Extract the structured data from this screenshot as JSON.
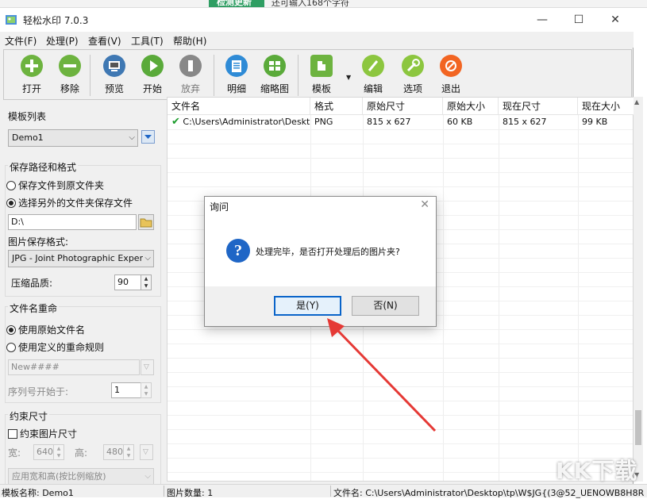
{
  "background": {
    "tab_label": "检测更新",
    "text": "还可输入168个字符"
  },
  "window": {
    "title": "轻松水印 7.0.3",
    "controls": {
      "minimize": "—",
      "maximize": "☐",
      "close": "✕"
    }
  },
  "menu": {
    "items": [
      "文件(F)",
      "处理(P)",
      "查看(V)",
      "工具(T)",
      "帮助(H)"
    ]
  },
  "toolbar": {
    "buttons": [
      {
        "label": "打开",
        "icon": "plus-icon",
        "color": "#6db33f"
      },
      {
        "label": "移除",
        "icon": "minus-icon",
        "color": "#6db33f"
      },
      {
        "label": "预览",
        "icon": "preview-icon",
        "color": "#3f78b3"
      },
      {
        "label": "开始",
        "icon": "play-icon",
        "color": "#5aaa3a"
      },
      {
        "label": "放弃",
        "icon": "stop-icon",
        "color": "#888888"
      },
      {
        "label": "明细",
        "icon": "detail-icon",
        "color": "#2f8bd6"
      },
      {
        "label": "缩略图",
        "icon": "thumbnail-icon",
        "color": "#5aaa3a"
      },
      {
        "label": "模板",
        "icon": "template-icon",
        "color": "#6db33f"
      },
      {
        "label": "编辑",
        "icon": "edit-icon",
        "color": "#8cc63f"
      },
      {
        "label": "选项",
        "icon": "options-icon",
        "color": "#8cc63f"
      },
      {
        "label": "退出",
        "icon": "exit-icon",
        "color": "#f26522"
      }
    ]
  },
  "left_panel": {
    "template_list": {
      "title": "模板列表",
      "selected": "Demo1"
    },
    "save_path": {
      "title": "保存路径和格式",
      "option_original": "保存文件到原文件夹",
      "option_other": "选择另外的文件夹保存文件",
      "path_value": "D:\\",
      "format_label": "图片保存格式:",
      "format_selected": "JPG - Joint Photographic Experts (",
      "quality_label": "压缩品质:",
      "quality_value": "90"
    },
    "rename": {
      "title": "文件名重命",
      "option_original": "使用原始文件名",
      "option_custom": "使用定义的重命规则",
      "pattern_value": "New####",
      "seq_label": "序列号开始于:",
      "seq_value": "1"
    },
    "constrain": {
      "title": "约束尺寸",
      "checkbox_label": "约束图片尺寸",
      "width_label": "宽:",
      "width_value": "640",
      "height_label": "高:",
      "height_value": "480",
      "mode_selected": "应用宽和高(按比例缩放)"
    }
  },
  "file_list": {
    "columns": [
      "文件名",
      "格式",
      "原始尺寸",
      "原始大小",
      "现在尺寸",
      "现在大小"
    ],
    "rows": [
      [
        "C:\\Users\\Administrator\\Deskt...",
        "PNG",
        "815 x 627",
        "60 KB",
        "815 x 627",
        "99 KB"
      ]
    ]
  },
  "status": {
    "template": "模板名称: Demo1",
    "count": "图片数量:  1",
    "filename": "文件名:  C:\\Users\\Administrator\\Desktop\\tp\\W$JG{(3@52_UENOWB8H8R"
  },
  "dialog": {
    "title": "询问",
    "message": "处理完毕，是否打开处理后的图片夹?",
    "yes": "是(Y)",
    "no": "否(N)"
  },
  "watermark": "KK下载"
}
